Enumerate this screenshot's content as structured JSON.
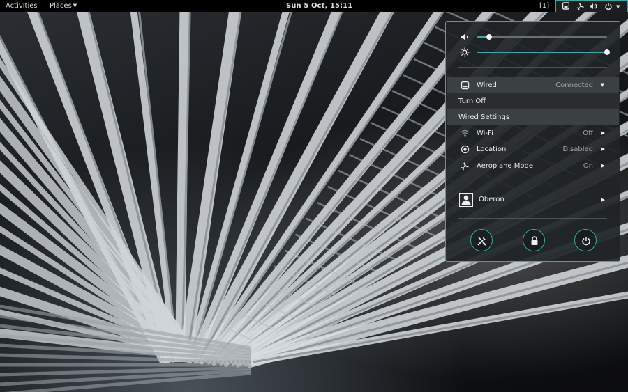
{
  "topbar": {
    "activities": "Activities",
    "places": "Places",
    "clock": "Sun  5 Oct, 15:11",
    "workspace_indicator": "[1]",
    "status_icons": [
      "network-wired-icon",
      "airplane-icon",
      "volume-icon",
      "power-icon",
      "chevron-down-icon"
    ]
  },
  "sliders": {
    "volume": {
      "icon": "volume-icon",
      "level": 0.09
    },
    "brightness": {
      "icon": "brightness-icon",
      "level": 1.0
    }
  },
  "network": {
    "label": "Wired",
    "status": "Connected",
    "icon": "network-wired-icon",
    "submenu": [
      {
        "label": "Turn Off"
      },
      {
        "label": "Wired Settings"
      }
    ]
  },
  "rows": [
    {
      "id": "wifi",
      "label": "Wi-Fi",
      "status": "Off",
      "icon": "wifi-icon"
    },
    {
      "id": "location",
      "label": "Location",
      "status": "Disabled",
      "icon": "location-icon"
    },
    {
      "id": "aeroplane",
      "label": "Aeroplane Mode",
      "status": "On",
      "icon": "airplane-icon"
    }
  ],
  "user": {
    "name": "Oberon",
    "icon": "avatar-icon"
  },
  "actions": [
    {
      "id": "settings",
      "icon": "settings-tools-icon"
    },
    {
      "id": "lock",
      "icon": "lock-icon"
    },
    {
      "id": "power",
      "icon": "power-icon"
    }
  ],
  "colors": {
    "accent": "#3aa9a3",
    "panel": "#000000",
    "menu_bg": "#202426",
    "status_text": "#a3a6a6"
  }
}
